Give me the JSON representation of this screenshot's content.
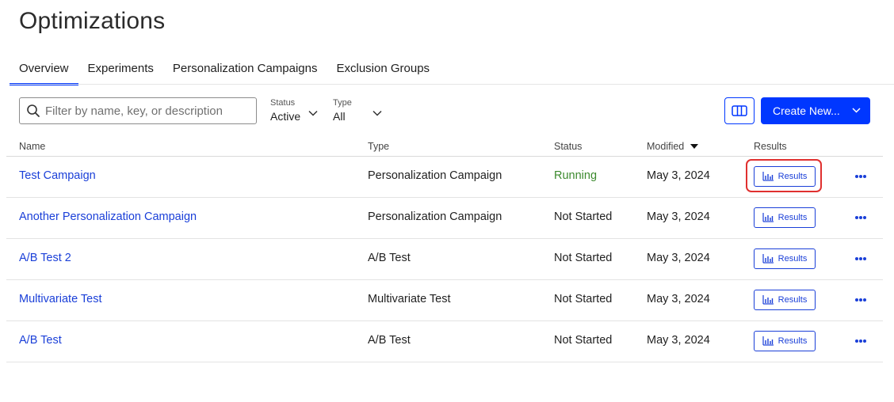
{
  "page": {
    "title": "Optimizations"
  },
  "tabs": [
    {
      "label": "Overview",
      "active": true
    },
    {
      "label": "Experiments",
      "active": false
    },
    {
      "label": "Personalization Campaigns",
      "active": false
    },
    {
      "label": "Exclusion Groups",
      "active": false
    }
  ],
  "toolbar": {
    "search_placeholder": "Filter by name, key, or description",
    "status_filter": {
      "label": "Status",
      "value": "Active"
    },
    "type_filter": {
      "label": "Type",
      "value": "All"
    },
    "create_label": "Create New...",
    "accent": "#0037ff"
  },
  "table": {
    "headers": {
      "name": "Name",
      "type": "Type",
      "status": "Status",
      "modified": "Modified",
      "results": "Results"
    },
    "sort": {
      "column": "Modified",
      "direction": "descending"
    },
    "rows": [
      {
        "name": "Test Campaign",
        "type": "Personalization Campaign",
        "status": "Running",
        "modified": "May 3, 2024",
        "results": "Results",
        "highlighted": true
      },
      {
        "name": "Another Personalization Campaign",
        "type": "Personalization Campaign",
        "status": "Not Started",
        "modified": "May 3, 2024",
        "results": "Results"
      },
      {
        "name": "A/B Test 2",
        "type": "A/B Test",
        "status": "Not Started",
        "modified": "May 3, 2024",
        "results": "Results"
      },
      {
        "name": "Multivariate Test",
        "type": "Multivariate Test",
        "status": "Not Started",
        "modified": "May 3, 2024",
        "results": "Results"
      },
      {
        "name": "A/B Test",
        "type": "A/B Test",
        "status": "Not Started",
        "modified": "May 3, 2024",
        "results": "Results"
      }
    ]
  },
  "colors": {
    "link": "#1a3fd8",
    "running": "#3c8a2e",
    "highlight": "#e0302f"
  }
}
